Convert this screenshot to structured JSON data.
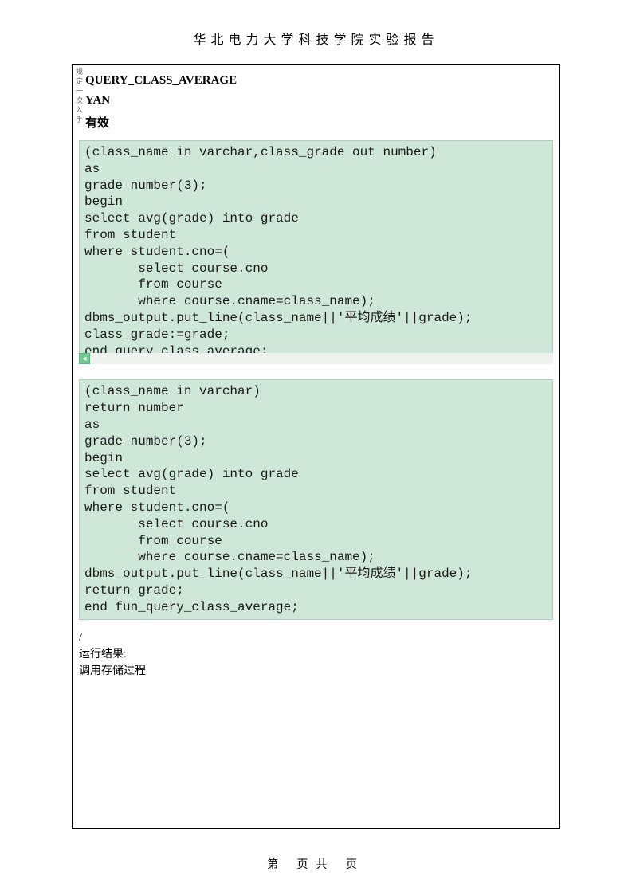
{
  "header": {
    "title": "华北电力大学科技学院实验报告"
  },
  "sideLabel": "规定一次入手",
  "info": {
    "procName": "QUERY_CLASS_AVERAGE",
    "owner": "YAN",
    "status": "有效"
  },
  "code1": "(class_name in varchar,class_grade out number)\nas\ngrade number(3);\nbegin\nselect avg(grade) into grade\nfrom student\nwhere student.cno=(\n       select course.cno\n       from course\n       where course.cname=class_name);\ndbms_output.put_line(class_name||'平均成绩'||grade);\nclass_grade:=grade;\nend query_class_average;",
  "code2": "(class_name in varchar)\nreturn number\nas\ngrade number(3);\nbegin\nselect avg(grade) into grade\nfrom student\nwhere student.cno=(\n       select course.cno\n       from course\n       where course.cname=class_name);\ndbms_output.put_line(class_name||'平均成绩'||grade);\nreturn grade;\nend fun_query_class_average;",
  "slash": "/",
  "results": {
    "line1": "运行结果:",
    "line2": "调用存储过程"
  },
  "footer": {
    "text": "第 页共 页"
  },
  "scrollArrow": "◂"
}
